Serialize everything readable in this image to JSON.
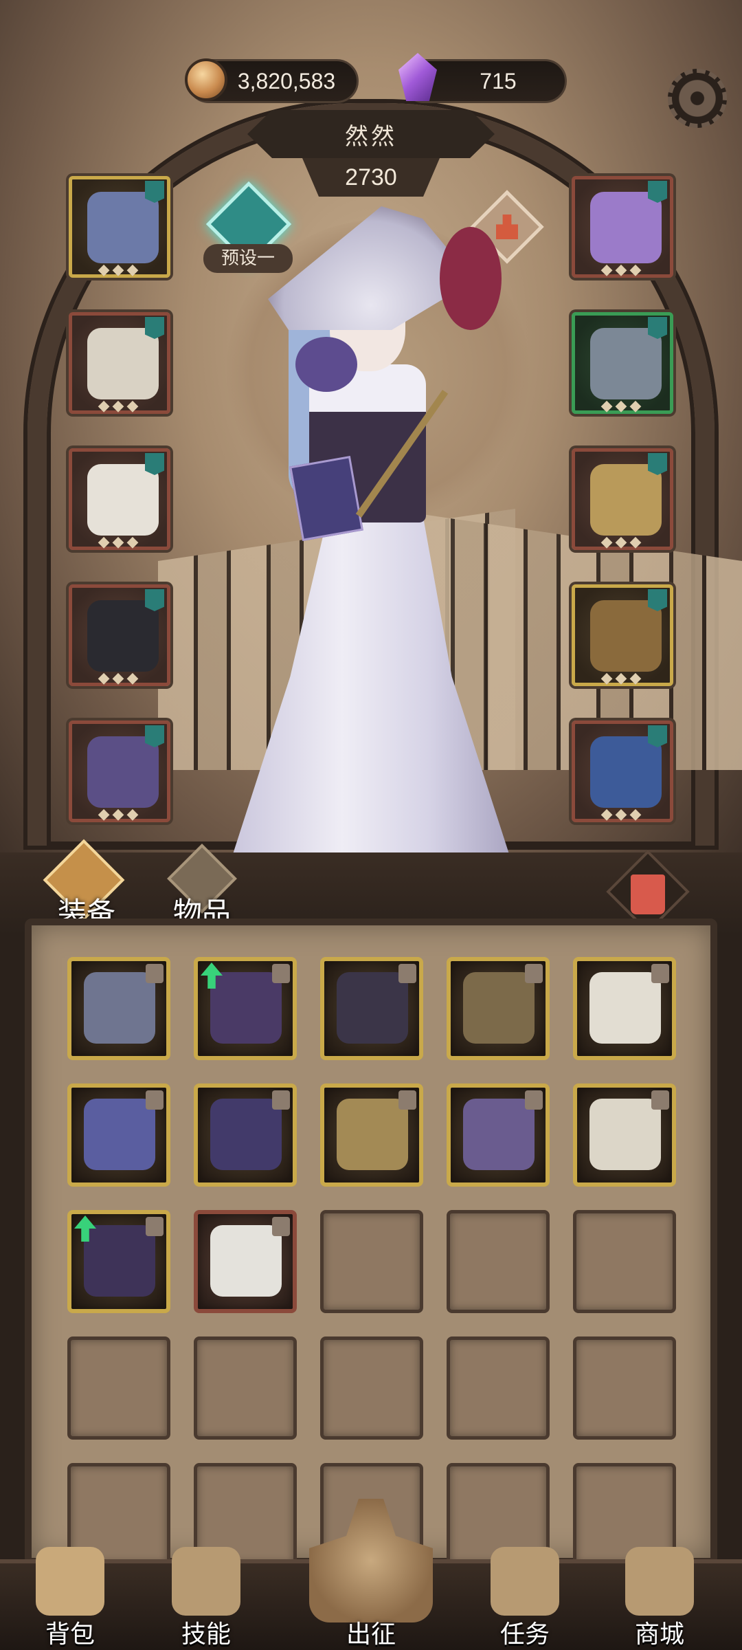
{
  "currency": {
    "coins": "3,820,583",
    "gems": "715"
  },
  "hero": {
    "name": "然然",
    "power": "2730",
    "preset_label": "预设一"
  },
  "equipment_slots": {
    "left": [
      {
        "name": "helmet-slot",
        "rarity": "gold",
        "art": "#6c7aa8"
      },
      {
        "name": "armor-slot",
        "rarity": "red",
        "art": "#d9d2c4"
      },
      {
        "name": "gloves-slot",
        "rarity": "red",
        "art": "#e6e1d8"
      },
      {
        "name": "pants-slot",
        "rarity": "red",
        "art": "#2a2a30"
      },
      {
        "name": "boots-slot",
        "rarity": "red",
        "art": "#5b4f86"
      }
    ],
    "right": [
      {
        "name": "necklace-slot",
        "rarity": "red",
        "art": "#9b7bc9"
      },
      {
        "name": "shoulder-slot",
        "rarity": "green",
        "art": "#7c8896"
      },
      {
        "name": "ring-slot",
        "rarity": "red",
        "art": "#b99a5a"
      },
      {
        "name": "weapon-slot",
        "rarity": "gold",
        "art": "#8a6a3c"
      },
      {
        "name": "shield-slot",
        "rarity": "red",
        "art": "#3d5b99"
      }
    ]
  },
  "tabs": {
    "equipment": "装备",
    "items": "物品"
  },
  "inventory": [
    {
      "filled": true,
      "rarity": "gold",
      "art": "#6f7590",
      "upgrade": false
    },
    {
      "filled": true,
      "rarity": "gold",
      "art": "#4a3a66",
      "upgrade": true
    },
    {
      "filled": true,
      "rarity": "gold",
      "art": "#3b3548",
      "upgrade": false
    },
    {
      "filled": true,
      "rarity": "gold",
      "art": "#7c6a4a",
      "upgrade": false
    },
    {
      "filled": true,
      "rarity": "gold",
      "art": "#e2ddd2",
      "upgrade": false
    },
    {
      "filled": true,
      "rarity": "gold",
      "art": "#5a5ea0",
      "upgrade": false
    },
    {
      "filled": true,
      "rarity": "gold",
      "art": "#423a6a",
      "upgrade": false
    },
    {
      "filled": true,
      "rarity": "gold",
      "art": "#a38a55",
      "upgrade": false
    },
    {
      "filled": true,
      "rarity": "gold",
      "art": "#6a5c8f",
      "upgrade": false
    },
    {
      "filled": true,
      "rarity": "gold",
      "art": "#dcd6c8",
      "upgrade": false
    },
    {
      "filled": true,
      "rarity": "gold",
      "art": "#3e3358",
      "upgrade": true
    },
    {
      "filled": true,
      "rarity": "red",
      "art": "#e4e2dc",
      "upgrade": false
    },
    {
      "filled": false
    },
    {
      "filled": false
    },
    {
      "filled": false
    },
    {
      "filled": false
    },
    {
      "filled": false
    },
    {
      "filled": false
    },
    {
      "filled": false
    },
    {
      "filled": false
    },
    {
      "filled": false
    },
    {
      "filled": false
    },
    {
      "filled": false
    },
    {
      "filled": false
    },
    {
      "filled": false
    }
  ],
  "nav": [
    {
      "label": "背包",
      "icon": "backpack-icon",
      "color": "#c9a97a"
    },
    {
      "label": "技能",
      "icon": "skills-icon",
      "color": "#b79a72"
    },
    {
      "label": "出征",
      "icon": "battle-icon",
      "color": "#c8a97f"
    },
    {
      "label": "任务",
      "icon": "quest-icon",
      "color": "#b79a72"
    },
    {
      "label": "商城",
      "icon": "shop-icon",
      "color": "#b79a72"
    }
  ]
}
